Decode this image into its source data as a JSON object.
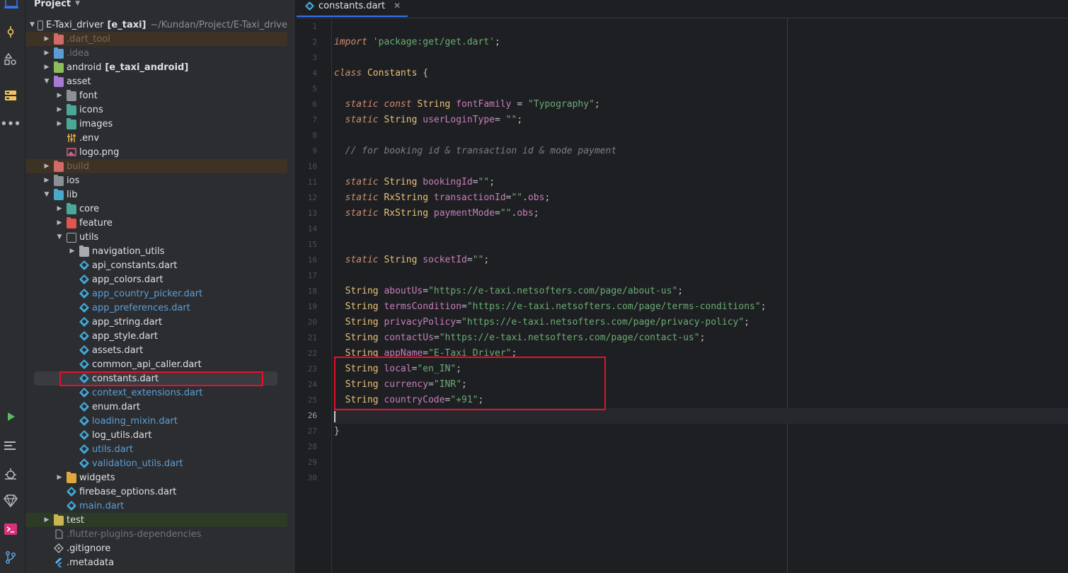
{
  "activity_bar": {
    "icons": [
      "project-icon",
      "commit-icon",
      "structure-icon",
      "bookmarks-icon",
      "more-icon",
      "run-icon",
      "todo-icon",
      "debug-icon",
      "flutter-inspector-icon",
      "terminal-icon",
      "git-icon"
    ]
  },
  "project_panel": {
    "title": "Project",
    "tree": [
      {
        "label": "E-Taxi_driver",
        "module": "[e_taxi]",
        "path": "~/Kundan/Project/E-Taxi_drive",
        "depth": 0,
        "expanded": true,
        "kind": "module-folder"
      },
      {
        "label": ".dart_tool",
        "depth": 1,
        "expanded": false,
        "kind": "excluded-folder"
      },
      {
        "label": ".idea",
        "depth": 1,
        "expanded": false,
        "kind": "idea-folder"
      },
      {
        "label": "android",
        "module": "[e_taxi_android]",
        "depth": 1,
        "expanded": false,
        "kind": "android-folder"
      },
      {
        "label": "asset",
        "depth": 1,
        "expanded": true,
        "kind": "resource-folder"
      },
      {
        "label": "font",
        "depth": 2,
        "expanded": false,
        "kind": "font-folder"
      },
      {
        "label": "icons",
        "depth": 2,
        "expanded": false,
        "kind": "icons-folder"
      },
      {
        "label": "images",
        "depth": 2,
        "expanded": false,
        "kind": "images-folder"
      },
      {
        "label": ".env",
        "depth": 2,
        "kind": "env-file"
      },
      {
        "label": "logo.png",
        "depth": 2,
        "kind": "image-file"
      },
      {
        "label": "build",
        "depth": 1,
        "expanded": false,
        "kind": "excluded-folder"
      },
      {
        "label": "ios",
        "depth": 1,
        "expanded": false,
        "kind": "ios-folder"
      },
      {
        "label": "lib",
        "depth": 1,
        "expanded": true,
        "kind": "source-folder"
      },
      {
        "label": "core",
        "depth": 2,
        "expanded": false,
        "kind": "core-folder"
      },
      {
        "label": "feature",
        "depth": 2,
        "expanded": false,
        "kind": "feature-folder"
      },
      {
        "label": "utils",
        "depth": 2,
        "expanded": true,
        "kind": "utils-folder"
      },
      {
        "label": "navigation_utils",
        "depth": 3,
        "expanded": false,
        "kind": "folder"
      },
      {
        "label": "api_constants.dart",
        "depth": 3,
        "kind": "dart-file"
      },
      {
        "label": "app_colors.dart",
        "depth": 3,
        "kind": "dart-file"
      },
      {
        "label": "app_country_picker.dart",
        "depth": 3,
        "kind": "dart-file-modified"
      },
      {
        "label": "app_preferences.dart",
        "depth": 3,
        "kind": "dart-file-modified"
      },
      {
        "label": "app_string.dart",
        "depth": 3,
        "kind": "dart-file"
      },
      {
        "label": "app_style.dart",
        "depth": 3,
        "kind": "dart-file"
      },
      {
        "label": "assets.dart",
        "depth": 3,
        "kind": "dart-file"
      },
      {
        "label": "common_api_caller.dart",
        "depth": 3,
        "kind": "dart-file"
      },
      {
        "label": "constants.dart",
        "depth": 3,
        "kind": "dart-file-selected"
      },
      {
        "label": "context_extensions.dart",
        "depth": 3,
        "kind": "dart-file-modified"
      },
      {
        "label": "enum.dart",
        "depth": 3,
        "kind": "dart-file"
      },
      {
        "label": "loading_mixin.dart",
        "depth": 3,
        "kind": "dart-file-modified"
      },
      {
        "label": "log_utils.dart",
        "depth": 3,
        "kind": "dart-file"
      },
      {
        "label": "utils.dart",
        "depth": 3,
        "kind": "dart-file-modified"
      },
      {
        "label": "validation_utils.dart",
        "depth": 3,
        "kind": "dart-file-modified"
      },
      {
        "label": "widgets",
        "depth": 2,
        "expanded": false,
        "kind": "widgets-folder"
      },
      {
        "label": "firebase_options.dart",
        "depth": 2,
        "kind": "dart-file"
      },
      {
        "label": "main.dart",
        "depth": 2,
        "kind": "dart-file-modified"
      },
      {
        "label": "test",
        "depth": 1,
        "expanded": false,
        "kind": "test-folder"
      },
      {
        "label": ".flutter-plugins-dependencies",
        "depth": 1,
        "kind": "ignored-file"
      },
      {
        "label": ".gitignore",
        "depth": 1,
        "kind": "gitignore-file"
      },
      {
        "label": ".metadata",
        "depth": 1,
        "kind": "flutter-file"
      }
    ]
  },
  "editor": {
    "tab_label": "constants.dart",
    "current_line": 26,
    "lines": [
      [],
      [
        [
          "kw",
          "import"
        ],
        [
          "pn",
          " "
        ],
        [
          "str",
          "'package:get/get.dart'"
        ],
        [
          "pn",
          ";"
        ]
      ],
      [],
      [
        [
          "kw",
          "class"
        ],
        [
          "pn",
          " "
        ],
        [
          "cls",
          "Constants"
        ],
        [
          "pn",
          " {"
        ]
      ],
      [],
      [
        [
          "pn",
          "  "
        ],
        [
          "kw",
          "static"
        ],
        [
          "pn",
          " "
        ],
        [
          "kw",
          "const"
        ],
        [
          "pn",
          " "
        ],
        [
          "ty",
          "String"
        ],
        [
          "pn",
          " "
        ],
        [
          "fld",
          "fontFamily"
        ],
        [
          "pn",
          " = "
        ],
        [
          "str",
          "\"Typography\""
        ],
        [
          "pn",
          ";"
        ]
      ],
      [
        [
          "pn",
          "  "
        ],
        [
          "kw",
          "static"
        ],
        [
          "pn",
          " "
        ],
        [
          "ty",
          "String"
        ],
        [
          "pn",
          " "
        ],
        [
          "fld",
          "userLoginType"
        ],
        [
          "pn",
          "= "
        ],
        [
          "str",
          "\"\""
        ],
        [
          "pn",
          ";"
        ]
      ],
      [],
      [
        [
          "pn",
          "  "
        ],
        [
          "cmt",
          "// for booking id & transaction id & mode payment"
        ]
      ],
      [],
      [
        [
          "pn",
          "  "
        ],
        [
          "kw",
          "static"
        ],
        [
          "pn",
          " "
        ],
        [
          "ty",
          "String"
        ],
        [
          "pn",
          " "
        ],
        [
          "fld",
          "bookingId"
        ],
        [
          "pn",
          "="
        ],
        [
          "str",
          "\"\""
        ],
        [
          "pn",
          ";"
        ]
      ],
      [
        [
          "pn",
          "  "
        ],
        [
          "kw",
          "static"
        ],
        [
          "pn",
          " "
        ],
        [
          "ty",
          "RxString"
        ],
        [
          "pn",
          " "
        ],
        [
          "fld",
          "transactionId"
        ],
        [
          "pn",
          "="
        ],
        [
          "str",
          "\"\""
        ],
        [
          "pn",
          "."
        ],
        [
          "fld",
          "obs"
        ],
        [
          "pn",
          ";"
        ]
      ],
      [
        [
          "pn",
          "  "
        ],
        [
          "kw",
          "static"
        ],
        [
          "pn",
          " "
        ],
        [
          "ty",
          "RxString"
        ],
        [
          "pn",
          " "
        ],
        [
          "fld",
          "paymentMode"
        ],
        [
          "pn",
          "="
        ],
        [
          "str",
          "\"\""
        ],
        [
          "pn",
          "."
        ],
        [
          "fld",
          "obs"
        ],
        [
          "pn",
          ";"
        ]
      ],
      [],
      [],
      [
        [
          "pn",
          "  "
        ],
        [
          "kw",
          "static"
        ],
        [
          "pn",
          " "
        ],
        [
          "ty",
          "String"
        ],
        [
          "pn",
          " "
        ],
        [
          "fld",
          "socketId"
        ],
        [
          "pn",
          "="
        ],
        [
          "str",
          "\"\""
        ],
        [
          "pn",
          ";"
        ]
      ],
      [],
      [
        [
          "pn",
          "  "
        ],
        [
          "ty",
          "String"
        ],
        [
          "pn",
          " "
        ],
        [
          "fld",
          "aboutUs"
        ],
        [
          "pn",
          "="
        ],
        [
          "str",
          "\"https://e-taxi.netsofters.com/page/about-us\""
        ],
        [
          "pn",
          ";"
        ]
      ],
      [
        [
          "pn",
          "  "
        ],
        [
          "ty",
          "String"
        ],
        [
          "pn",
          " "
        ],
        [
          "fld",
          "termsCondition"
        ],
        [
          "pn",
          "="
        ],
        [
          "str",
          "\"https://e-taxi.netsofters.com/page/terms-conditions\""
        ],
        [
          "pn",
          ";"
        ]
      ],
      [
        [
          "pn",
          "  "
        ],
        [
          "ty",
          "String"
        ],
        [
          "pn",
          " "
        ],
        [
          "fld",
          "privacyPolicy"
        ],
        [
          "pn",
          "="
        ],
        [
          "str",
          "\"https://e-taxi.netsofters.com/page/privacy-policy\""
        ],
        [
          "pn",
          ";"
        ]
      ],
      [
        [
          "pn",
          "  "
        ],
        [
          "ty",
          "String"
        ],
        [
          "pn",
          " "
        ],
        [
          "fld",
          "contactUs"
        ],
        [
          "pn",
          "="
        ],
        [
          "str",
          "\"https://e-taxi.netsofters.com/page/contact-us\""
        ],
        [
          "pn",
          ";"
        ]
      ],
      [
        [
          "pn",
          "  "
        ],
        [
          "ty",
          "String"
        ],
        [
          "pn",
          " "
        ],
        [
          "fld",
          "appName"
        ],
        [
          "pn",
          "="
        ],
        [
          "str",
          "\"E-Taxi Driver\""
        ],
        [
          "pn",
          ";"
        ]
      ],
      [
        [
          "pn",
          "  "
        ],
        [
          "ty",
          "String"
        ],
        [
          "pn",
          " "
        ],
        [
          "fld",
          "local"
        ],
        [
          "pn",
          "="
        ],
        [
          "str",
          "\"en_IN\""
        ],
        [
          "pn",
          ";"
        ]
      ],
      [
        [
          "pn",
          "  "
        ],
        [
          "ty",
          "String"
        ],
        [
          "pn",
          " "
        ],
        [
          "fld",
          "currency"
        ],
        [
          "pn",
          "="
        ],
        [
          "str",
          "\"INR\""
        ],
        [
          "pn",
          ";"
        ]
      ],
      [
        [
          "pn",
          "  "
        ],
        [
          "ty",
          "String"
        ],
        [
          "pn",
          " "
        ],
        [
          "fld",
          "countryCode"
        ],
        [
          "pn",
          "="
        ],
        [
          "str",
          "\"+91\""
        ],
        [
          "pn",
          ";"
        ]
      ],
      [],
      [
        [
          "pn",
          "}"
        ]
      ],
      [],
      [],
      []
    ]
  },
  "colors": {
    "highlight": "#e8102a",
    "accent": "#3574f0",
    "dart": "#3fa9d8"
  }
}
